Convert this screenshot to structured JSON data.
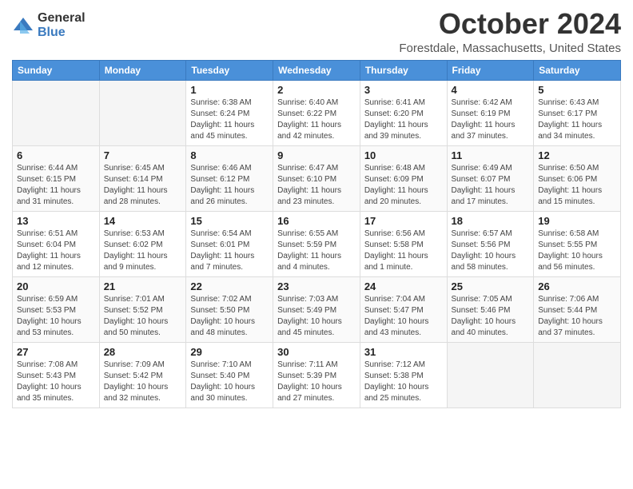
{
  "header": {
    "logo_general": "General",
    "logo_blue": "Blue",
    "month_title": "October 2024",
    "location": "Forestdale, Massachusetts, United States"
  },
  "days_of_week": [
    "Sunday",
    "Monday",
    "Tuesday",
    "Wednesday",
    "Thursday",
    "Friday",
    "Saturday"
  ],
  "weeks": [
    [
      {
        "day": "",
        "empty": true
      },
      {
        "day": "",
        "empty": true
      },
      {
        "day": "1",
        "sunrise": "Sunrise: 6:38 AM",
        "sunset": "Sunset: 6:24 PM",
        "daylight": "Daylight: 11 hours and 45 minutes."
      },
      {
        "day": "2",
        "sunrise": "Sunrise: 6:40 AM",
        "sunset": "Sunset: 6:22 PM",
        "daylight": "Daylight: 11 hours and 42 minutes."
      },
      {
        "day": "3",
        "sunrise": "Sunrise: 6:41 AM",
        "sunset": "Sunset: 6:20 PM",
        "daylight": "Daylight: 11 hours and 39 minutes."
      },
      {
        "day": "4",
        "sunrise": "Sunrise: 6:42 AM",
        "sunset": "Sunset: 6:19 PM",
        "daylight": "Daylight: 11 hours and 37 minutes."
      },
      {
        "day": "5",
        "sunrise": "Sunrise: 6:43 AM",
        "sunset": "Sunset: 6:17 PM",
        "daylight": "Daylight: 11 hours and 34 minutes."
      }
    ],
    [
      {
        "day": "6",
        "sunrise": "Sunrise: 6:44 AM",
        "sunset": "Sunset: 6:15 PM",
        "daylight": "Daylight: 11 hours and 31 minutes."
      },
      {
        "day": "7",
        "sunrise": "Sunrise: 6:45 AM",
        "sunset": "Sunset: 6:14 PM",
        "daylight": "Daylight: 11 hours and 28 minutes."
      },
      {
        "day": "8",
        "sunrise": "Sunrise: 6:46 AM",
        "sunset": "Sunset: 6:12 PM",
        "daylight": "Daylight: 11 hours and 26 minutes."
      },
      {
        "day": "9",
        "sunrise": "Sunrise: 6:47 AM",
        "sunset": "Sunset: 6:10 PM",
        "daylight": "Daylight: 11 hours and 23 minutes."
      },
      {
        "day": "10",
        "sunrise": "Sunrise: 6:48 AM",
        "sunset": "Sunset: 6:09 PM",
        "daylight": "Daylight: 11 hours and 20 minutes."
      },
      {
        "day": "11",
        "sunrise": "Sunrise: 6:49 AM",
        "sunset": "Sunset: 6:07 PM",
        "daylight": "Daylight: 11 hours and 17 minutes."
      },
      {
        "day": "12",
        "sunrise": "Sunrise: 6:50 AM",
        "sunset": "Sunset: 6:06 PM",
        "daylight": "Daylight: 11 hours and 15 minutes."
      }
    ],
    [
      {
        "day": "13",
        "sunrise": "Sunrise: 6:51 AM",
        "sunset": "Sunset: 6:04 PM",
        "daylight": "Daylight: 11 hours and 12 minutes."
      },
      {
        "day": "14",
        "sunrise": "Sunrise: 6:53 AM",
        "sunset": "Sunset: 6:02 PM",
        "daylight": "Daylight: 11 hours and 9 minutes."
      },
      {
        "day": "15",
        "sunrise": "Sunrise: 6:54 AM",
        "sunset": "Sunset: 6:01 PM",
        "daylight": "Daylight: 11 hours and 7 minutes."
      },
      {
        "day": "16",
        "sunrise": "Sunrise: 6:55 AM",
        "sunset": "Sunset: 5:59 PM",
        "daylight": "Daylight: 11 hours and 4 minutes."
      },
      {
        "day": "17",
        "sunrise": "Sunrise: 6:56 AM",
        "sunset": "Sunset: 5:58 PM",
        "daylight": "Daylight: 11 hours and 1 minute."
      },
      {
        "day": "18",
        "sunrise": "Sunrise: 6:57 AM",
        "sunset": "Sunset: 5:56 PM",
        "daylight": "Daylight: 10 hours and 58 minutes."
      },
      {
        "day": "19",
        "sunrise": "Sunrise: 6:58 AM",
        "sunset": "Sunset: 5:55 PM",
        "daylight": "Daylight: 10 hours and 56 minutes."
      }
    ],
    [
      {
        "day": "20",
        "sunrise": "Sunrise: 6:59 AM",
        "sunset": "Sunset: 5:53 PM",
        "daylight": "Daylight: 10 hours and 53 minutes."
      },
      {
        "day": "21",
        "sunrise": "Sunrise: 7:01 AM",
        "sunset": "Sunset: 5:52 PM",
        "daylight": "Daylight: 10 hours and 50 minutes."
      },
      {
        "day": "22",
        "sunrise": "Sunrise: 7:02 AM",
        "sunset": "Sunset: 5:50 PM",
        "daylight": "Daylight: 10 hours and 48 minutes."
      },
      {
        "day": "23",
        "sunrise": "Sunrise: 7:03 AM",
        "sunset": "Sunset: 5:49 PM",
        "daylight": "Daylight: 10 hours and 45 minutes."
      },
      {
        "day": "24",
        "sunrise": "Sunrise: 7:04 AM",
        "sunset": "Sunset: 5:47 PM",
        "daylight": "Daylight: 10 hours and 43 minutes."
      },
      {
        "day": "25",
        "sunrise": "Sunrise: 7:05 AM",
        "sunset": "Sunset: 5:46 PM",
        "daylight": "Daylight: 10 hours and 40 minutes."
      },
      {
        "day": "26",
        "sunrise": "Sunrise: 7:06 AM",
        "sunset": "Sunset: 5:44 PM",
        "daylight": "Daylight: 10 hours and 37 minutes."
      }
    ],
    [
      {
        "day": "27",
        "sunrise": "Sunrise: 7:08 AM",
        "sunset": "Sunset: 5:43 PM",
        "daylight": "Daylight: 10 hours and 35 minutes."
      },
      {
        "day": "28",
        "sunrise": "Sunrise: 7:09 AM",
        "sunset": "Sunset: 5:42 PM",
        "daylight": "Daylight: 10 hours and 32 minutes."
      },
      {
        "day": "29",
        "sunrise": "Sunrise: 7:10 AM",
        "sunset": "Sunset: 5:40 PM",
        "daylight": "Daylight: 10 hours and 30 minutes."
      },
      {
        "day": "30",
        "sunrise": "Sunrise: 7:11 AM",
        "sunset": "Sunset: 5:39 PM",
        "daylight": "Daylight: 10 hours and 27 minutes."
      },
      {
        "day": "31",
        "sunrise": "Sunrise: 7:12 AM",
        "sunset": "Sunset: 5:38 PM",
        "daylight": "Daylight: 10 hours and 25 minutes."
      },
      {
        "day": "",
        "empty": true
      },
      {
        "day": "",
        "empty": true
      }
    ]
  ]
}
